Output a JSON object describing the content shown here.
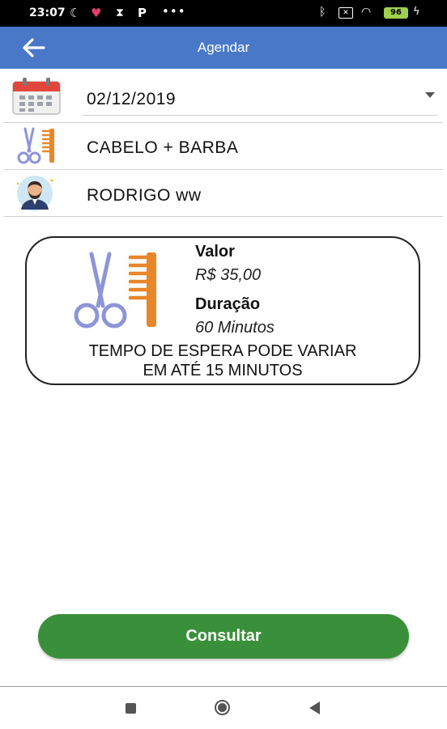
{
  "status_bar": {
    "time": "23:07",
    "battery": "96"
  },
  "app_bar": {
    "title": "Agendar"
  },
  "form": {
    "date_value": "02/12/2019",
    "service_value": "CABELO + BARBA",
    "professional_value": "RODRIGO ww"
  },
  "info_card": {
    "price_label": "Valor",
    "price_value": "R$ 35,00",
    "duration_label": "Duração",
    "duration_value": "60 Minutos",
    "notice_line1": "TEMPO DE ESPERA PODE VARIAR",
    "notice_line2": "EM ATÉ 15 MINUTOS"
  },
  "actions": {
    "consult_label": "Consultar"
  },
  "colors": {
    "app_bar": "#4a78c9",
    "button": "#3a8f3a",
    "comb": "#e8862a",
    "scissors": "#8e95d6",
    "calendar_red": "#e2463b"
  },
  "icons": {
    "back": "arrow-left-icon",
    "date": "calendar-icon",
    "service": "scissors-comb-icon",
    "professional": "barber-avatar-icon"
  }
}
